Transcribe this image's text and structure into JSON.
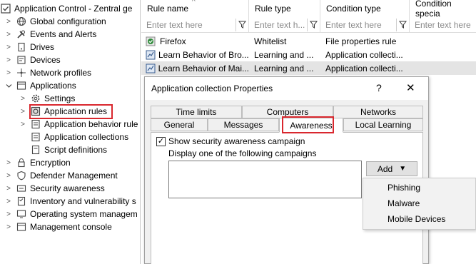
{
  "tree": {
    "items": [
      {
        "label": "Application Control - Zentral ge",
        "chevron": "",
        "icon": "shield-check-icon"
      },
      {
        "label": "Global configuration",
        "chevron": ">",
        "icon": "globe-icon"
      },
      {
        "label": "Events and Alerts",
        "chevron": ">",
        "icon": "tools-icon"
      },
      {
        "label": "Drives",
        "chevron": ">",
        "icon": "drive-icon"
      },
      {
        "label": "Devices",
        "chevron": ">",
        "icon": "devices-icon"
      },
      {
        "label": "Network profiles",
        "chevron": ">",
        "icon": "network-icon"
      },
      {
        "label": "Applications",
        "chevron": "v",
        "icon": "applications-icon"
      },
      {
        "label": "Settings",
        "chevron": ">",
        "icon": "gear-icon"
      },
      {
        "label": "Application rules",
        "chevron": ">",
        "icon": "rule-icon"
      },
      {
        "label": "Application behavior rule",
        "chevron": ">",
        "icon": "behavior-icon"
      },
      {
        "label": "Application collections",
        "chevron": "",
        "icon": "collection-icon"
      },
      {
        "label": "Script definitions",
        "chevron": "",
        "icon": "script-icon"
      },
      {
        "label": "Encryption",
        "chevron": ">",
        "icon": "lock-icon"
      },
      {
        "label": "Defender Management",
        "chevron": ">",
        "icon": "defender-icon"
      },
      {
        "label": "Security awareness",
        "chevron": ">",
        "icon": "awareness-icon"
      },
      {
        "label": "Inventory and vulnerability s",
        "chevron": ">",
        "icon": "inventory-icon"
      },
      {
        "label": "Operating system managem",
        "chevron": ">",
        "icon": "os-icon"
      },
      {
        "label": "Management console",
        "chevron": ">",
        "icon": "console-icon"
      }
    ]
  },
  "grid": {
    "columns": [
      {
        "label": "Rule name",
        "placeholder": "Enter text here",
        "sort_glyph": "^"
      },
      {
        "label": "Rule type",
        "placeholder": "Enter text h..."
      },
      {
        "label": "Condition type",
        "placeholder": "Enter text here"
      },
      {
        "label": "Condition specia",
        "placeholder": "Enter text here"
      }
    ],
    "rows": [
      {
        "name": "Firefox",
        "type": "Whitelist",
        "condition": "File properties rule",
        "icon": "firefox-whitelist-icon",
        "selected": false
      },
      {
        "name": "Learn Behavior of Bro...",
        "type": "Learning and ...",
        "condition": "Application collecti...",
        "icon": "learn-behavior-icon",
        "selected": false
      },
      {
        "name": "Learn Behavior of Mai...",
        "type": "Learning and ...",
        "condition": "Application collecti...",
        "icon": "learn-behavior-icon",
        "selected": true
      }
    ]
  },
  "dialog": {
    "title": "Application collection Properties",
    "help": "?",
    "close": "✕",
    "tabs_row1": [
      "Time limits",
      "Computers",
      "Networks"
    ],
    "tabs_row2": [
      "General",
      "Messages",
      "Awareness",
      "Local Learning"
    ],
    "active_tab": "Awareness",
    "checkbox_label": "Show security awareness campaign",
    "checkbox_checked": true,
    "checkbox_mark": "✓",
    "list_label": "Display one of the following campaigns",
    "add_button": "Add",
    "add_arrow": "▼"
  },
  "menu": {
    "items": [
      "Phishing",
      "Malware",
      "Mobile Devices"
    ]
  },
  "colors": {
    "highlight": "#d9272e",
    "selected_row": "#e4e4e4",
    "dialog_bg": "#f0f0f0"
  }
}
